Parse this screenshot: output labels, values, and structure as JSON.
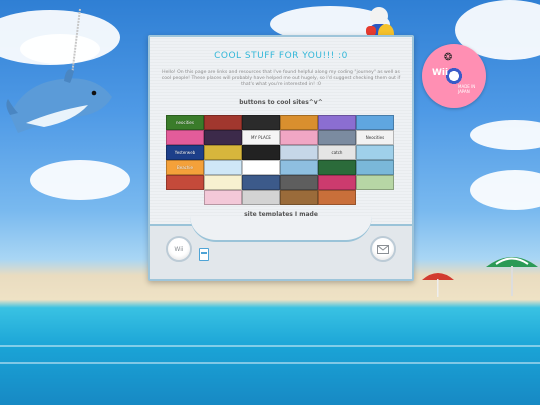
{
  "page": {
    "title": "COOL STUFF FOR YOU!!! :0",
    "intro": "Hello! On this page are links and resources that I've found helpful along my coding \"journey\" as well as cool people! These places will probably have helped me out hugely, so I'd suggest checking them out if that's what you're interested in! :0",
    "buttons_heading": "buttons to cool sites^v^",
    "templates_heading": "site templates I made"
  },
  "disc": {
    "label": "Wii",
    "sub": "MADE IN JAPAN"
  },
  "menu_bar": {
    "left_button": "Wii",
    "right_icon": "mail-icon"
  },
  "buttons88": [
    {
      "label": "neocities",
      "color": "#3a7c2a"
    },
    {
      "label": "",
      "color": "#a1372e"
    },
    {
      "label": "",
      "color": "#2b2b2b"
    },
    {
      "label": "",
      "color": "#d98f2e"
    },
    {
      "label": "",
      "color": "#8b6ed1"
    },
    {
      "label": "",
      "color": "#5fa6e0"
    },
    {
      "label": "",
      "color": "#e35c9a"
    },
    {
      "label": "",
      "color": "#3c2a4a"
    },
    {
      "label": "MY PLACE",
      "color": "#f5f5f5"
    },
    {
      "label": "",
      "color": "#f0a6c4"
    },
    {
      "label": "",
      "color": "#7b8ba0"
    },
    {
      "label": "Neocities",
      "color": "#f2f2f2"
    },
    {
      "label": "Yesterweb",
      "color": "#1d3f8a"
    },
    {
      "label": "",
      "color": "#d7b63c"
    },
    {
      "label": "",
      "color": "#222"
    },
    {
      "label": "",
      "color": "#c6d7e8"
    },
    {
      "label": "catch",
      "color": "#e5e5e5"
    },
    {
      "label": "",
      "color": "#9fd0ea"
    },
    {
      "label": "Beachie",
      "color": "#f4a13a"
    },
    {
      "label": "",
      "color": "#cfe7f7"
    },
    {
      "label": "",
      "color": "#ffffff"
    },
    {
      "label": "",
      "color": "#8ebfe0"
    },
    {
      "label": "",
      "color": "#2b6b3a"
    },
    {
      "label": "",
      "color": "#7ab8d9"
    },
    {
      "label": "",
      "color": "#c44a3a"
    },
    {
      "label": "",
      "color": "#f7f1d0"
    },
    {
      "label": "",
      "color": "#3c5a8a"
    },
    {
      "label": "",
      "color": "#5e5e5e"
    },
    {
      "label": "",
      "color": "#cc3b6e"
    },
    {
      "label": "",
      "color": "#b7d6a5"
    },
    {
      "label": "",
      "color": "#f3c8d8"
    },
    {
      "label": "",
      "color": "#d3d3d3"
    },
    {
      "label": "",
      "color": "#9a6b3a"
    },
    {
      "label": "",
      "color": "#c96f3a"
    }
  ]
}
